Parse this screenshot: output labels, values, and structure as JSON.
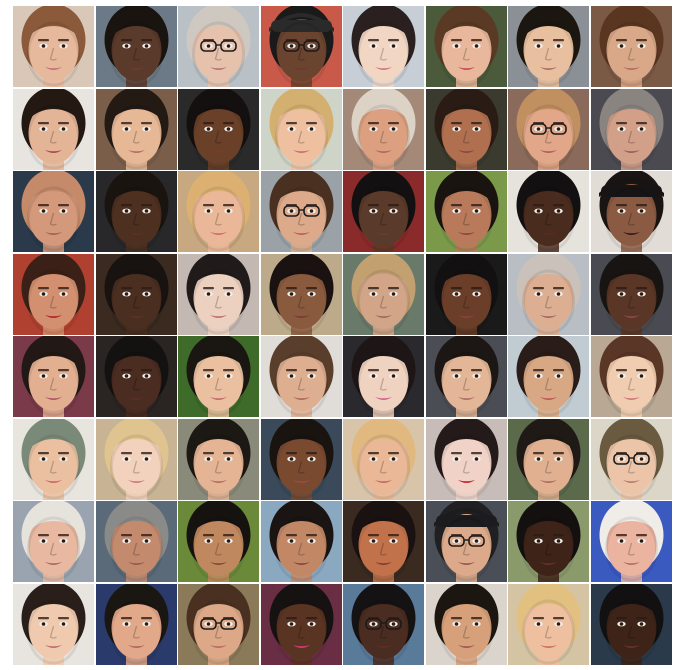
{
  "grid": {
    "rows": 8,
    "columns": 8,
    "cells": [
      {
        "bg": "#d9c8b8",
        "skin": "#e7b99c",
        "hair": "#8a5a3a",
        "lip": "#c9707a"
      },
      {
        "bg": "#6b7a86",
        "skin": "#5a3a2a",
        "hair": "#1a1410",
        "lip": "#6a3a34"
      },
      {
        "bg": "#b9c0c6",
        "skin": "#e6c2ad",
        "hair": "#cfc8c0",
        "lip": "#b77a72",
        "glasses": true
      },
      {
        "bg": "#c95a4a",
        "skin": "#6a442e",
        "hair": "#1a1a1a",
        "lip": "#6b3a30",
        "glasses": true,
        "cap": "#2a2a2a"
      },
      {
        "bg": "#c8ced6",
        "skin": "#f1d6c4",
        "hair": "#2a2020",
        "lip": "#d07a80"
      },
      {
        "bg": "#4a5a3a",
        "skin": "#e9b89c",
        "hair": "#5a3a24",
        "lip": "#c4505a"
      },
      {
        "bg": "#8a9096",
        "skin": "#e8c0a0",
        "hair": "#1c1610",
        "lip": "#b0706a"
      },
      {
        "bg": "#7a5a44",
        "skin": "#d9a888",
        "hair": "#5a3620",
        "lip": "#b86a62"
      },
      {
        "bg": "#e8e4e0",
        "skin": "#e4b496",
        "hair": "#231812",
        "lip": "#b04a58"
      },
      {
        "bg": "#7a5e4a",
        "skin": "#e6b896",
        "hair": "#241a14",
        "lip": "#b6706a"
      },
      {
        "bg": "#2a2a2a",
        "skin": "#6a4028",
        "hair": "#141010",
        "lip": "#7a3a34"
      },
      {
        "bg": "#cfd4c8",
        "skin": "#eec0a0",
        "hair": "#d4b070",
        "lip": "#d07070"
      },
      {
        "bg": "#a48878",
        "skin": "#dca080",
        "hair": "#dcd2c6",
        "lip": "#b06a60"
      },
      {
        "bg": "#3a3a2e",
        "skin": "#b07050",
        "hair": "#2a1c14",
        "lip": "#8a4a40"
      },
      {
        "bg": "#8a6a5a",
        "skin": "#e2a688",
        "hair": "#c09060",
        "lip": "#b06060",
        "glasses": true
      },
      {
        "bg": "#4a4a50",
        "skin": "#d2a088",
        "hair": "#8a8480",
        "lip": "#9a6058"
      },
      {
        "bg": "#2a3a4a",
        "skin": "#d4987a",
        "hair": "#c48a6a",
        "lip": "#a46656"
      },
      {
        "bg": "#28282a",
        "skin": "#4e3020",
        "hair": "#1a1410",
        "lip": "#5a302a"
      },
      {
        "bg": "#c8a880",
        "skin": "#eab898",
        "hair": "#dcb070",
        "lip": "#d0706a"
      },
      {
        "bg": "#9aa2a8",
        "skin": "#dcaa8a",
        "hair": "#4a3020",
        "lip": "#c0605a",
        "glasses": true
      },
      {
        "bg": "#8a2a2a",
        "skin": "#5a3a2a",
        "hair": "#121010",
        "lip": "#6a3a30"
      },
      {
        "bg": "#7a9a4a",
        "skin": "#b87a5a",
        "hair": "#1a1410",
        "lip": "#8a4a40"
      },
      {
        "bg": "#e6e2dc",
        "skin": "#4a2c1e",
        "hair": "#121010",
        "lip": "#5a2a26"
      },
      {
        "bg": "#e2dcd6",
        "skin": "#8a5a42",
        "hair": "#1a1412",
        "lip": "#3a1a1c",
        "cap": "#161414"
      },
      {
        "bg": "#b04030",
        "skin": "#d29070",
        "hair": "#3a2016",
        "lip": "#b02a2a"
      },
      {
        "bg": "#3a2a20",
        "skin": "#4a2e20",
        "hair": "#181210",
        "lip": "#5a302a"
      },
      {
        "bg": "#c4b8b2",
        "skin": "#ecd0c0",
        "hair": "#201a1a",
        "lip": "#c2707a"
      },
      {
        "bg": "#bcaa8a",
        "skin": "#8a5a3e",
        "hair": "#1a1210",
        "lip": "#7a3a36"
      },
      {
        "bg": "#6a7a6a",
        "skin": "#d2a488",
        "hair": "#c2a070",
        "lip": "#a06a5e"
      },
      {
        "bg": "#1a1a1a",
        "skin": "#6a3e28",
        "hair": "#121010",
        "lip": "#8a4040"
      },
      {
        "bg": "#b8bec4",
        "skin": "#dcae92",
        "hair": "#cac2ba",
        "lip": "#a66a60"
      },
      {
        "bg": "#4a4a52",
        "skin": "#5a3626",
        "hair": "#181412",
        "lip": "#8a4a44"
      },
      {
        "bg": "#7a3a4a",
        "skin": "#e2b090",
        "hair": "#221816",
        "lip": "#b05a66"
      },
      {
        "bg": "#2a2422",
        "skin": "#4a2c20",
        "hair": "#141210",
        "lip": "#5a2e28"
      },
      {
        "bg": "#3e6a2a",
        "skin": "#eac0a0",
        "hair": "#1a1612",
        "lip": "#c07070"
      },
      {
        "bg": "#e0ddd8",
        "skin": "#deae90",
        "hair": "#5a3e2c",
        "lip": "#b06a62"
      },
      {
        "bg": "#2a2a2e",
        "skin": "#f0d2c0",
        "hair": "#1e1616",
        "lip": "#d06a88"
      },
      {
        "bg": "#4a4e54",
        "skin": "#e2b696",
        "hair": "#1c1614",
        "lip": "#b2706a"
      },
      {
        "bg": "#c0ccd2",
        "skin": "#d8a884",
        "hair": "#2a1c18",
        "lip": "#c05a5a"
      },
      {
        "bg": "#b8a894",
        "skin": "#f0ccb0",
        "hair": "#5a3626",
        "lip": "#d07a7a"
      },
      {
        "bg": "#e8e4de",
        "skin": "#eac0a0",
        "hair": "#7a8a78",
        "lip": "#d06a6a"
      },
      {
        "bg": "#c8b494",
        "skin": "#f2d2bc",
        "hair": "#e0c490",
        "lip": "#d47a80"
      },
      {
        "bg": "#8a8a7a",
        "skin": "#e4b494",
        "hair": "#1c1814",
        "lip": "#b67068"
      },
      {
        "bg": "#3a4a5a",
        "skin": "#7a4a30",
        "hair": "#1a1410",
        "lip": "#9a4a44"
      },
      {
        "bg": "#d8c4a8",
        "skin": "#eab896",
        "hair": "#e0b880",
        "lip": "#c86a60"
      },
      {
        "bg": "#c8bcb8",
        "skin": "#f0d2c6",
        "hair": "#241a1a",
        "lip": "#c62a38"
      },
      {
        "bg": "#5a6a4a",
        "skin": "#e0b090",
        "hair": "#201a16",
        "lip": "#b46a64"
      },
      {
        "bg": "#dcd6c8",
        "skin": "#ecc4a8",
        "hair": "#6a5a40",
        "lip": "#c07a70",
        "glasses": true
      },
      {
        "bg": "#9aa4b0",
        "skin": "#e8b8a0",
        "hair": "#e6e2dc",
        "lip": "#b06a66"
      },
      {
        "bg": "#5a6a78",
        "skin": "#c48a6e",
        "hair": "#8a8a88",
        "lip": "#9a5a50"
      },
      {
        "bg": "#6a8a3a",
        "skin": "#c0885e",
        "hair": "#161210",
        "lip": "#8a4a40"
      },
      {
        "bg": "#8aa8c0",
        "skin": "#c28866",
        "hair": "#1a1412",
        "lip": "#8a4a40"
      },
      {
        "bg": "#3a2a20",
        "skin": "#c2724a",
        "hair": "#1a1210",
        "lip": "#8a3a30"
      },
      {
        "bg": "#4a4e56",
        "skin": "#dcaa8a",
        "hair": "#202022",
        "lip": "#9a5a52",
        "glasses": true,
        "cap": "#1c1c1e"
      },
      {
        "bg": "#8a9a6a",
        "skin": "#3e2418",
        "hair": "#141010",
        "lip": "#6a2e2a"
      },
      {
        "bg": "#3a5ac0",
        "skin": "#eab4a0",
        "hair": "#f0ece8",
        "lip": "#b86a6a"
      },
      {
        "bg": "#e8e4e0",
        "skin": "#f0caae",
        "hair": "#2a1e1a",
        "lip": "#c27070"
      },
      {
        "bg": "#2a3a6a",
        "skin": "#e2a88a",
        "hair": "#1a1612",
        "lip": "#b06a60"
      },
      {
        "bg": "#8a7a5a",
        "skin": "#dca888",
        "hair": "#4a3020",
        "lip": "#c06a64",
        "glasses": true
      },
      {
        "bg": "#6a2e44",
        "skin": "#5a3422",
        "hair": "#161212",
        "lip": "#d03a7a"
      },
      {
        "bg": "#5a7a9a",
        "skin": "#4a2c20",
        "hair": "#141212",
        "lip": "#5a302a",
        "glasses": true
      },
      {
        "bg": "#dad4cc",
        "skin": "#d6a07a",
        "hair": "#1c1610",
        "lip": "#a45a50"
      },
      {
        "bg": "#d4c4a4",
        "skin": "#eec0a0",
        "hair": "#e2c080",
        "lip": "#d0706a"
      },
      {
        "bg": "#2a3a4a",
        "skin": "#3e2418",
        "hair": "#121010",
        "lip": "#6a302c"
      }
    ]
  }
}
